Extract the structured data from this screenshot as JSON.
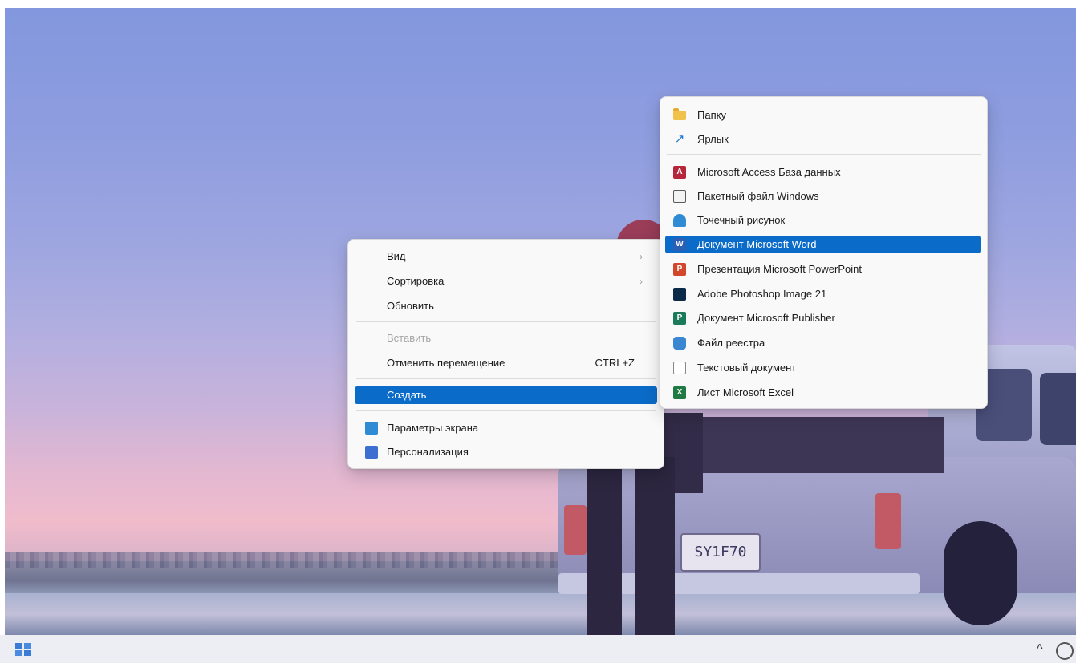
{
  "context_menu": {
    "items": [
      {
        "label": "Вид",
        "arrow": "›"
      },
      {
        "label": "Сортировка",
        "arrow": "›"
      },
      {
        "label": "Обновить"
      },
      {
        "label": "Вставить"
      },
      {
        "label": "Отменить перемещение",
        "shortcut": "CTRL+Z"
      },
      {
        "label": "Создать"
      },
      {
        "label": "Параметры экрана"
      },
      {
        "label": "Персонализация"
      }
    ],
    "selected_index": 5,
    "disabled_index": 3
  },
  "new_submenu": {
    "items": [
      {
        "label": "Папку",
        "icon": "folder-icon"
      },
      {
        "label": "Ярлык",
        "icon": "shortcut-arrow-icon"
      },
      {
        "label": "Microsoft Access База данных",
        "icon": "access-icon"
      },
      {
        "label": "Пакетный файл Windows",
        "icon": "batch-file-icon"
      },
      {
        "label": "Точечный рисунок",
        "icon": "bitmap-icon"
      },
      {
        "label": "Документ Microsoft Word",
        "icon": "word-icon"
      },
      {
        "label": "Презентация Microsoft PowerPoint",
        "icon": "powerpoint-icon"
      },
      {
        "label": "Adobe Photoshop Image 21",
        "icon": "photoshop-icon"
      },
      {
        "label": "Документ Microsoft Publisher",
        "icon": "publisher-icon"
      },
      {
        "label": "Файл реестра",
        "icon": "registry-icon"
      },
      {
        "label": "Текстовый документ",
        "icon": "text-document-icon"
      },
      {
        "label": "Лист Microsoft Excel",
        "icon": "excel-icon"
      }
    ],
    "selected_index": 5
  },
  "wallpaper": {
    "license_plate": "SY1F70"
  },
  "colors": {
    "selection": "#0b6bc8",
    "menu_background": "#f9f9f9"
  }
}
